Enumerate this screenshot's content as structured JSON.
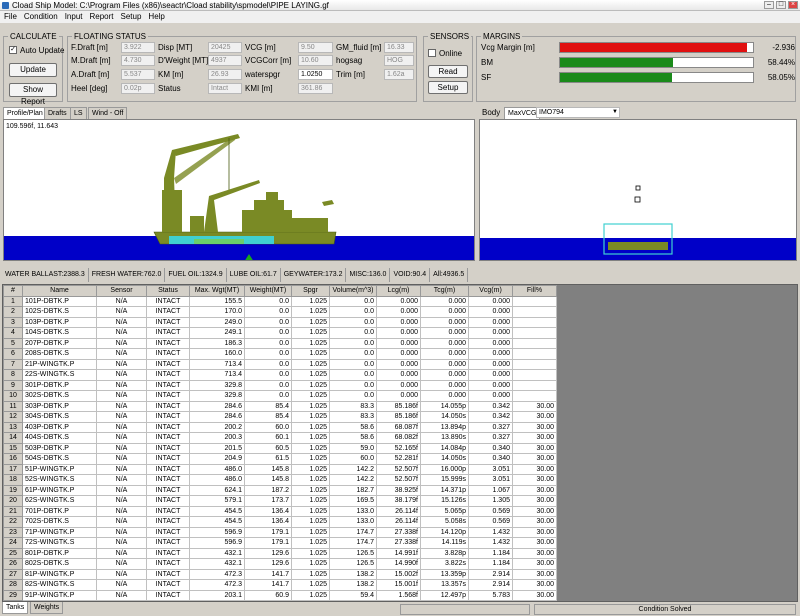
{
  "window": {
    "title": "Cload  Ship Model: C:\\Program Files (x86)\\seactr\\Cload stability\\spmodel\\PIPE LAYING.gf"
  },
  "menu": [
    "File",
    "Condition",
    "Input",
    "Report",
    "Setup",
    "Help"
  ],
  "calculate": {
    "title": "CALCULATE",
    "auto_update": "Auto Update",
    "update": "Update",
    "show_report": "Show Report"
  },
  "floating": {
    "title": "FLOATING STATUS",
    "fdraft_label": "F.Draft [m]",
    "fdraft": "3.922",
    "mdraft_label": "M.Draft [m]",
    "mdraft": "4.730",
    "adraft_label": "A.Draft [m]",
    "adraft": "5.537",
    "heel_label": "Heel [deg]",
    "heel": "0.02p",
    "disp_label": "Disp [MT]",
    "disp": "20425",
    "dwt_label": "D'Weight [MT]",
    "dwt": "4937",
    "km_label": "KM [m]",
    "km": "26.93",
    "status_label": "Status",
    "status": "Intact",
    "vcg_label": "VCG [m]",
    "vcg": "9.50",
    "vcgcorr_label": "VCGCorr [m]",
    "vcgcorr": "10.60",
    "waterspgr_label": "waterspgr",
    "waterspgr": "1.0250",
    "kmi_label": "KMI [m]",
    "kmi": "361.86",
    "gm_label": "GM_fluid [m]",
    "gm": "16.33",
    "hogsag_label": "hogsag",
    "hogsag": "HOG",
    "trim_label": "Trim [m]",
    "trim": "1.62a"
  },
  "sensors": {
    "title": "SENSORS",
    "online": "Online",
    "read": "Read",
    "setup": "Setup"
  },
  "margins": {
    "title": "MARGINS",
    "vcg_label": "Vcg Margin [m]",
    "vcg_value": "-2.936",
    "vcg_fill": 0.97,
    "vcg_color": "#e01010",
    "bm_label": "BM",
    "bm_value": "58.44%",
    "bm_fill": 0.5844,
    "bm_color": "#1a8a1a",
    "sf_label": "SF",
    "sf_value": "58.05%",
    "sf_fill": 0.5805,
    "sf_color": "#1a8a1a"
  },
  "view_tabs": {
    "profile": "Profile/Plan",
    "drafts": "Drafts",
    "ls": "LS",
    "wind": "Wind - Off"
  },
  "coord_readout": "109.596f, 11.643",
  "body_tabs": {
    "body": "Body",
    "maxvcg": "MaxVCG",
    "select": "IMO794"
  },
  "summary": [
    "WATER BALLAST:2388.3",
    "FRESH WATER:762.0",
    "FUEL OIL:1324.9",
    "LUBE OIL:61.7",
    "GEYWATER:173.2",
    "MISC:136.0",
    "VOID:90.4",
    "All:4936.5"
  ],
  "columns": [
    "#",
    "Name",
    "Sensor",
    "Status",
    "Max. Wgt(MT)",
    "Weight(MT)",
    "Spgr",
    "Volume(m^3)",
    "Lcg(m)",
    "Tcg(m)",
    "Vcg(m)",
    "Fill%"
  ],
  "rows": [
    [
      "1",
      "101P-DBTK.P",
      "N/A",
      "INTACT",
      "155.5",
      "0.0",
      "1.025",
      "0.0",
      "0.000",
      "0.000",
      "0.000",
      ""
    ],
    [
      "2",
      "102S-DBTK.S",
      "N/A",
      "INTACT",
      "170.0",
      "0.0",
      "1.025",
      "0.0",
      "0.000",
      "0.000",
      "0.000",
      ""
    ],
    [
      "3",
      "103P-DBTK.P",
      "N/A",
      "INTACT",
      "249.0",
      "0.0",
      "1.025",
      "0.0",
      "0.000",
      "0.000",
      "0.000",
      ""
    ],
    [
      "4",
      "104S-DBTK.S",
      "N/A",
      "INTACT",
      "249.1",
      "0.0",
      "1.025",
      "0.0",
      "0.000",
      "0.000",
      "0.000",
      ""
    ],
    [
      "5",
      "207P-DBTK.P",
      "N/A",
      "INTACT",
      "186.3",
      "0.0",
      "1.025",
      "0.0",
      "0.000",
      "0.000",
      "0.000",
      ""
    ],
    [
      "6",
      "208S-DBTK.S",
      "N/A",
      "INTACT",
      "160.0",
      "0.0",
      "1.025",
      "0.0",
      "0.000",
      "0.000",
      "0.000",
      ""
    ],
    [
      "7",
      "21P-WINGTK.P",
      "N/A",
      "INTACT",
      "713.4",
      "0.0",
      "1.025",
      "0.0",
      "0.000",
      "0.000",
      "0.000",
      ""
    ],
    [
      "8",
      "22S-WINGTK.S",
      "N/A",
      "INTACT",
      "713.4",
      "0.0",
      "1.025",
      "0.0",
      "0.000",
      "0.000",
      "0.000",
      ""
    ],
    [
      "9",
      "301P-DBTK.P",
      "N/A",
      "INTACT",
      "329.8",
      "0.0",
      "1.025",
      "0.0",
      "0.000",
      "0.000",
      "0.000",
      ""
    ],
    [
      "10",
      "302S-DBTK.S",
      "N/A",
      "INTACT",
      "329.8",
      "0.0",
      "1.025",
      "0.0",
      "0.000",
      "0.000",
      "0.000",
      ""
    ],
    [
      "11",
      "303P-DBTK.P",
      "N/A",
      "INTACT",
      "284.6",
      "85.4",
      "1.025",
      "83.3",
      "85.186f",
      "14.055p",
      "0.342",
      "30.00"
    ],
    [
      "12",
      "304S-DBTK.S",
      "N/A",
      "INTACT",
      "284.6",
      "85.4",
      "1.025",
      "83.3",
      "85.186f",
      "14.050s",
      "0.342",
      "30.00"
    ],
    [
      "13",
      "403P-DBTK.P",
      "N/A",
      "INTACT",
      "200.2",
      "60.0",
      "1.025",
      "58.6",
      "68.087f",
      "13.894p",
      "0.327",
      "30.00"
    ],
    [
      "14",
      "404S-DBTK.S",
      "N/A",
      "INTACT",
      "200.3",
      "60.1",
      "1.025",
      "58.6",
      "68.082f",
      "13.890s",
      "0.327",
      "30.00"
    ],
    [
      "15",
      "503P-DBTK.P",
      "N/A",
      "INTACT",
      "201.5",
      "60.5",
      "1.025",
      "59.0",
      "52.165f",
      "14.084p",
      "0.340",
      "30.00"
    ],
    [
      "16",
      "504S-DBTK.S",
      "N/A",
      "INTACT",
      "204.9",
      "61.5",
      "1.025",
      "60.0",
      "52.281f",
      "14.050s",
      "0.340",
      "30.00"
    ],
    [
      "17",
      "51P-WINGTK.P",
      "N/A",
      "INTACT",
      "486.0",
      "145.8",
      "1.025",
      "142.2",
      "52.507f",
      "16.000p",
      "3.051",
      "30.00"
    ],
    [
      "18",
      "52S-WINGTK.S",
      "N/A",
      "INTACT",
      "486.0",
      "145.8",
      "1.025",
      "142.2",
      "52.507f",
      "15.999s",
      "3.051",
      "30.00"
    ],
    [
      "19",
      "61P-WINGTK.P",
      "N/A",
      "INTACT",
      "624.1",
      "187.2",
      "1.025",
      "182.7",
      "38.925f",
      "14.371p",
      "1.067",
      "30.00"
    ],
    [
      "20",
      "62S-WINGTK.S",
      "N/A",
      "INTACT",
      "579.1",
      "173.7",
      "1.025",
      "169.5",
      "38.179f",
      "15.126s",
      "1.305",
      "30.00"
    ],
    [
      "21",
      "701P-DBTK.P",
      "N/A",
      "INTACT",
      "454.5",
      "136.4",
      "1.025",
      "133.0",
      "26.114f",
      "5.065p",
      "0.569",
      "30.00"
    ],
    [
      "22",
      "702S-DBTK.S",
      "N/A",
      "INTACT",
      "454.5",
      "136.4",
      "1.025",
      "133.0",
      "26.114f",
      "5.058s",
      "0.569",
      "30.00"
    ],
    [
      "23",
      "71P-WINGTK.P",
      "N/A",
      "INTACT",
      "596.9",
      "179.1",
      "1.025",
      "174.7",
      "27.338f",
      "14.120p",
      "1.432",
      "30.00"
    ],
    [
      "24",
      "72S-WINGTK.S",
      "N/A",
      "INTACT",
      "596.9",
      "179.1",
      "1.025",
      "174.7",
      "27.338f",
      "14.119s",
      "1.432",
      "30.00"
    ],
    [
      "25",
      "801P-DBTK.P",
      "N/A",
      "INTACT",
      "432.1",
      "129.6",
      "1.025",
      "126.5",
      "14.991f",
      "3.828p",
      "1.184",
      "30.00"
    ],
    [
      "26",
      "802S-DBTK.S",
      "N/A",
      "INTACT",
      "432.1",
      "129.6",
      "1.025",
      "126.5",
      "14.990f",
      "3.822s",
      "1.184",
      "30.00"
    ],
    [
      "27",
      "81P-WINGTK.P",
      "N/A",
      "INTACT",
      "472.3",
      "141.7",
      "1.025",
      "138.2",
      "15.002f",
      "13.359p",
      "2.914",
      "30.00"
    ],
    [
      "28",
      "82S-WINGTK.S",
      "N/A",
      "INTACT",
      "472.3",
      "141.7",
      "1.025",
      "138.2",
      "15.001f",
      "13.357s",
      "2.914",
      "30.00"
    ],
    [
      "29",
      "91P-WINGTK.P",
      "N/A",
      "INTACT",
      "203.1",
      "60.9",
      "1.025",
      "59.4",
      "1.568f",
      "12.497p",
      "5.783",
      "30.00"
    ],
    [
      "30",
      "92S-WINGTK.S",
      "N/A",
      "INTACT",
      "203.1",
      "60.9",
      "1.025",
      "59.4",
      "1.568f",
      "12.492s",
      "5.783",
      "30.00"
    ]
  ],
  "bottom_tabs": {
    "tanks": "Tanks",
    "weights": "Weights"
  },
  "status": {
    "condition": "Condition Solved"
  }
}
